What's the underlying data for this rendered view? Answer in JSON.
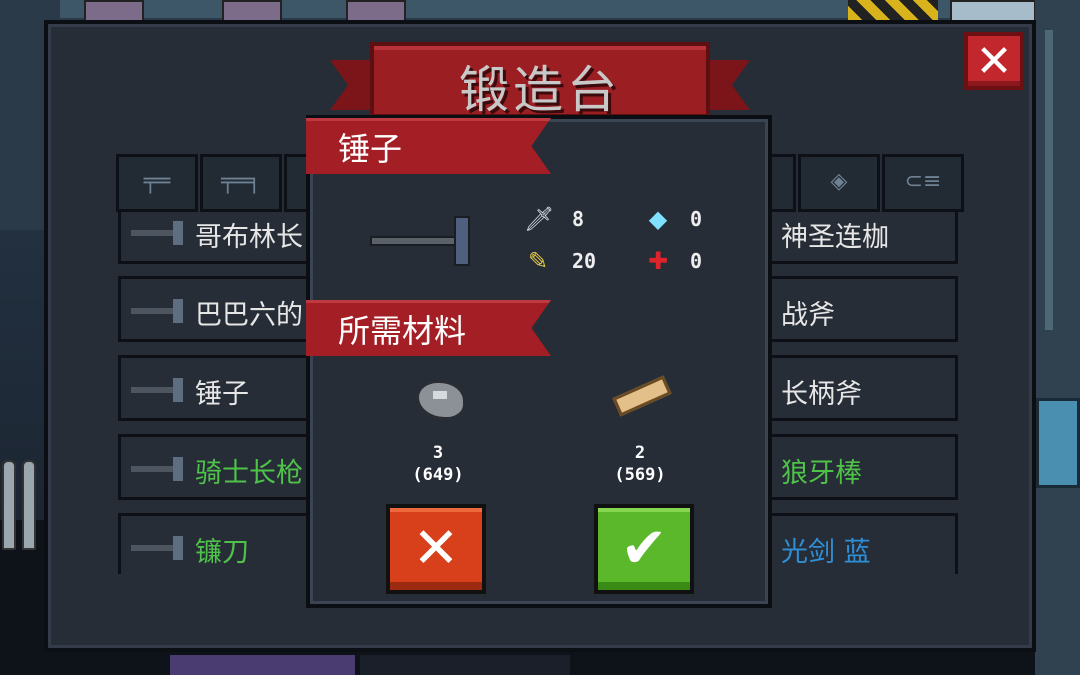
{
  "panel": {
    "title": "锻造台",
    "close_icon": "close-x-icon"
  },
  "tabs": [
    {
      "icon": "pistol-icon",
      "glyph": "╤═"
    },
    {
      "icon": "rifle-icon",
      "glyph": "╤═╕"
    },
    {
      "icon": "shotgun-icon",
      "glyph": "═"
    },
    {
      "icon": "launcher-icon",
      "glyph": "━"
    },
    {
      "icon": "shuriken-icon",
      "glyph": "◈"
    },
    {
      "icon": "fish-gun-icon",
      "glyph": "⊂≡"
    }
  ],
  "weapons_left": [
    {
      "name": "哥布林长",
      "color": "#e6e6e6"
    },
    {
      "name": "巴巴六的",
      "color": "#e6e6e6"
    },
    {
      "name": "锤子",
      "color": "#e6e6e6"
    },
    {
      "name": "骑士长枪",
      "color": "#4fc24a"
    },
    {
      "name": "镰刀",
      "color": "#4fc24a"
    }
  ],
  "weapons_right": [
    {
      "name": "神圣连枷",
      "color": "#e6e6e6"
    },
    {
      "name": "战斧",
      "color": "#e6e6e6"
    },
    {
      "name": "长柄斧",
      "color": "#e6e6e6"
    },
    {
      "name": "狼牙棒",
      "color": "#4fc24a"
    },
    {
      "name": "光剑 蓝",
      "color": "#2f8fd6"
    }
  ],
  "detail": {
    "weapon_name": "锤子",
    "materials_title": "所需材料",
    "stats": {
      "attack": {
        "icon": "sword-icon",
        "glyph": "🗡",
        "value": "8"
      },
      "energy": {
        "icon": "diamond-icon",
        "glyph": "◆",
        "value": "0"
      },
      "crit": {
        "icon": "pencil-icon",
        "glyph": "✎",
        "value": "20"
      },
      "spread": {
        "icon": "crosshair-icon",
        "glyph": "✚",
        "value": "0"
      }
    },
    "materials": [
      {
        "icon": "iron-ore-icon",
        "need": "3",
        "have": "(649)"
      },
      {
        "icon": "wood-plank-icon",
        "need": "2",
        "have": "(569)"
      }
    ],
    "cancel_glyph": "✕",
    "confirm_glyph": "✔"
  }
}
